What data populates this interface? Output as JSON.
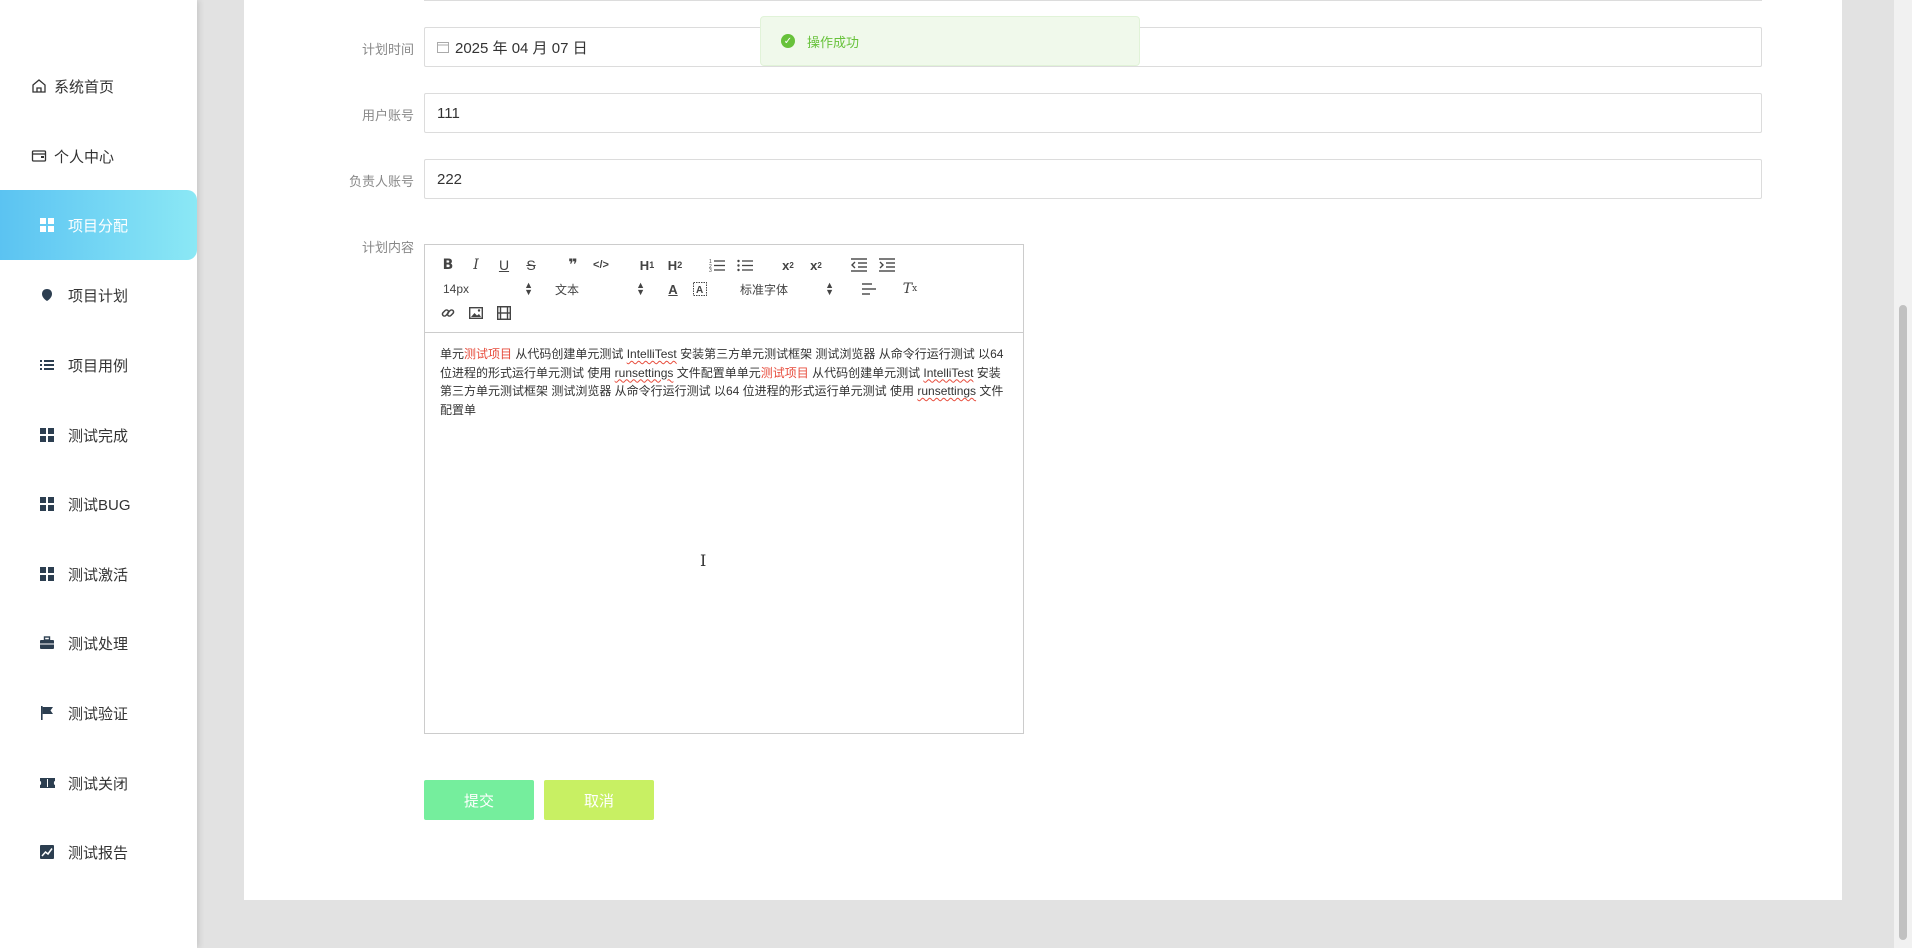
{
  "sidebar": {
    "items": [
      {
        "label": "系统首页",
        "icon": "home-icon"
      },
      {
        "label": "个人中心",
        "icon": "wallet-icon"
      },
      {
        "label": "项目分配",
        "icon": "grid-icon",
        "active": true
      },
      {
        "label": "项目计划",
        "icon": "pin-icon"
      },
      {
        "label": "项目用例",
        "icon": "list-icon"
      },
      {
        "label": "测试完成",
        "icon": "grid-icon"
      },
      {
        "label": "测试BUG",
        "icon": "grid-icon"
      },
      {
        "label": "测试激活",
        "icon": "grid-icon"
      },
      {
        "label": "测试处理",
        "icon": "briefcase-icon"
      },
      {
        "label": "测试验证",
        "icon": "flag-icon"
      },
      {
        "label": "测试关闭",
        "icon": "ticket-icon"
      },
      {
        "label": "测试报告",
        "icon": "chart-icon"
      }
    ]
  },
  "toast": {
    "message": "操作成功"
  },
  "form": {
    "plan_time": {
      "label": "计划时间",
      "value": "2025 年 04 月 07 日"
    },
    "user_account": {
      "label": "用户账号",
      "value": "111"
    },
    "owner_account": {
      "label": "负责人账号",
      "value": "222"
    },
    "plan_content": {
      "label": "计划内容"
    }
  },
  "editor": {
    "font_size": "14px",
    "text_type": "文本",
    "font_family": "标准字体",
    "content": {
      "p1": "单元",
      "r1": "测试项目",
      "p2": " 从代码创建单元测试 ",
      "s1": "IntelliTest",
      "p3": " 安装第三方单元测试框架 测试浏览器 从命令行运行测试 以64 位进程的形式运行单元测试 使用 ",
      "s2": "runsettings",
      "p4": " 文件配置单单元",
      "r2": "测试项目",
      "p5": " 从代码创建单元测试 ",
      "s3": "IntelliTest",
      "p6": " 安装第三方单元测试框架 测试浏览器 从命令行运行测试 以64 位进程的形式运行单元测试 使用 ",
      "s4": "runsettings",
      "p7": " 文件配置单"
    }
  },
  "buttons": {
    "submit": "提交",
    "cancel": "取消"
  },
  "colors": {
    "accent": "#5bc3f2",
    "submit": "#75ee9d",
    "cancel": "#c8f063",
    "success": "#67c23a"
  }
}
